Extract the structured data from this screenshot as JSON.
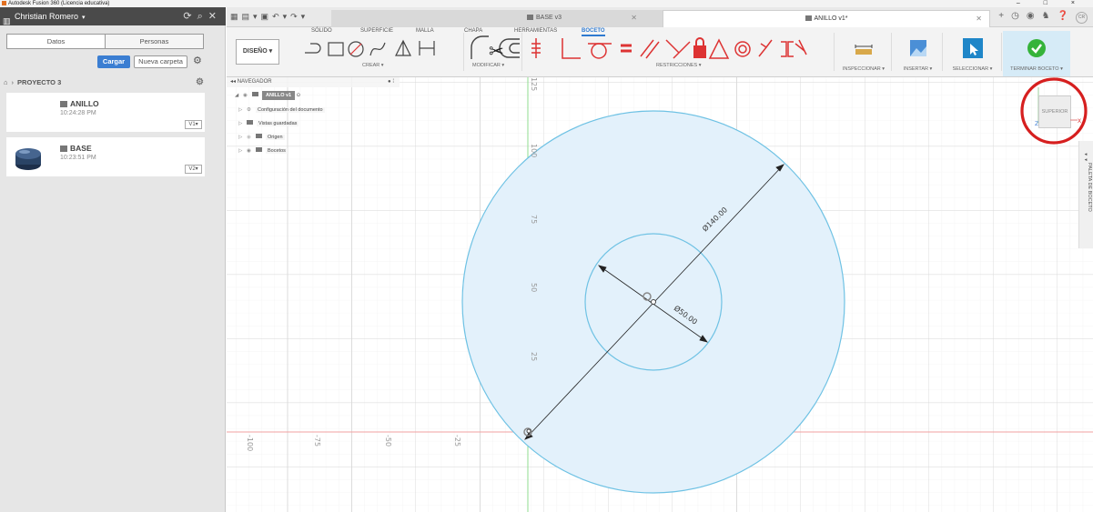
{
  "window": {
    "title": "Autodesk Fusion 360 (Licencia educativa)",
    "controls": "– □ ×"
  },
  "data_panel": {
    "user": "Christian Romero",
    "tabs": [
      "Datos",
      "Personas"
    ],
    "upload_button": "Cargar",
    "new_folder_button": "Nueva carpeta",
    "breadcrumb_project": "PROYECTO 3",
    "files": [
      {
        "name": "ANILLO",
        "time": "10:24:28 PM",
        "version": "V1"
      },
      {
        "name": "BASE",
        "time": "10:23:51 PM",
        "version": "V2"
      }
    ]
  },
  "document_tabs": [
    {
      "name": "BASE v3",
      "active": false
    },
    {
      "name": "ANILLO v1*",
      "active": true
    }
  ],
  "user_initials": "CR",
  "workspace_tabs": [
    "SÓLIDO",
    "SUPERFICIE",
    "MALLA",
    "CHAPA",
    "HERRAMIENTAS",
    "BOCETO"
  ],
  "active_workspace_tab": "BOCETO",
  "toolbar": {
    "design_menu": "DISEÑO",
    "groups": {
      "create": "CREAR",
      "modify": "MODIFICAR",
      "constraints": "RESTRICCIONES",
      "inspect": "INSPECCIONAR",
      "insert": "INSERTAR",
      "select": "SELECCIONAR",
      "finish": "TERMINAR BOCETO"
    }
  },
  "navigator": {
    "title": "NAVEGADOR",
    "root": "ANILLO v1",
    "items": [
      "Configuración del documento",
      "Vistas guardadas",
      "Origen",
      "Bocetos"
    ]
  },
  "sketch": {
    "outer_diameter": "Ø140.00",
    "inner_diameter": "Ø50.00",
    "y_ticks": [
      "125",
      "100",
      "75",
      "50",
      "25"
    ],
    "x_ticks": [
      "-100",
      "-75",
      "-50",
      "-25"
    ]
  },
  "view_cube": {
    "face": "SUPERIOR",
    "axis_x": "X",
    "axis_z": "Z"
  },
  "sketch_palette": "PALETA DE BOCETO",
  "colors": {
    "accent": "#2f7ad0",
    "sketch_fill": "#e3f1fb",
    "sketch_stroke": "#6fc2e4",
    "highlight_ring": "#d61f1f",
    "axis_red": "#f2a0a0",
    "axis_green": "#8fdc8f"
  }
}
